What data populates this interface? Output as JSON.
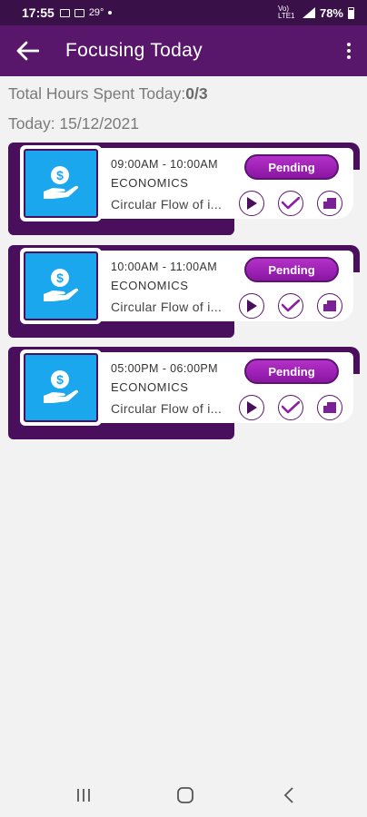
{
  "status_bar": {
    "time": "17:55",
    "temperature": "29°",
    "net_label": "Vo) LTE1",
    "battery": "78%"
  },
  "app_bar": {
    "title": "Focusing Today"
  },
  "summary": {
    "hours_label": "Total Hours Spent Today:",
    "hours_value": "0/3",
    "today_label": "Today: 15/12/2021"
  },
  "sessions": [
    {
      "time": "09:00AM - 10:00AM",
      "subject": "ECONOMICS",
      "topic": "Circular Flow of i...",
      "status": "Pending"
    },
    {
      "time": "10:00AM - 11:00AM",
      "subject": "ECONOMICS",
      "topic": "Circular Flow of i...",
      "status": "Pending"
    },
    {
      "time": "05:00PM - 06:00PM",
      "subject": "ECONOMICS",
      "topic": "Circular Flow of i...",
      "status": "Pending"
    }
  ],
  "icons": {
    "back": "arrow-left-icon",
    "menu": "more-vertical-icon",
    "subject": "hand-money-icon",
    "play": "play-icon",
    "check": "check-icon",
    "chat": "chat-icon",
    "nav_recent": "recents-icon",
    "nav_home": "home-icon",
    "nav_back": "back-chevron-icon"
  },
  "colors": {
    "app_bar": "#58176b",
    "status_bar": "#3a1049",
    "card_accent": "#4a0f5c",
    "icon_bg": "#1ba7ee",
    "pending": "#a11fb8"
  }
}
